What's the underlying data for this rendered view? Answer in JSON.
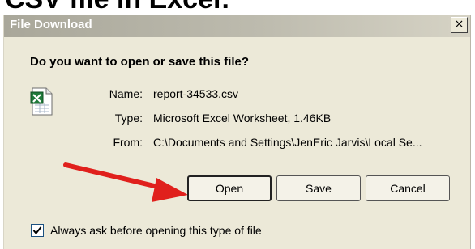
{
  "page_heading": "CSV file in Excel:",
  "dialog": {
    "title": "File Download",
    "close_glyph": "×",
    "question": "Do you want to open or save this file?",
    "file_icon": "excel-file-icon",
    "fields": {
      "name_label": "Name:",
      "name_value": "report-34533.csv",
      "type_label": "Type:",
      "type_value": "Microsoft Excel Worksheet, 1.46KB",
      "from_label": "From:",
      "from_value": "C:\\Documents and Settings\\JenEric Jarvis\\Local Se..."
    },
    "buttons": {
      "open": "Open",
      "save": "Save",
      "cancel": "Cancel"
    },
    "checkbox": {
      "label": "Always ask before opening this type of file",
      "checked": true
    },
    "arrow_color": "#e0201c"
  }
}
